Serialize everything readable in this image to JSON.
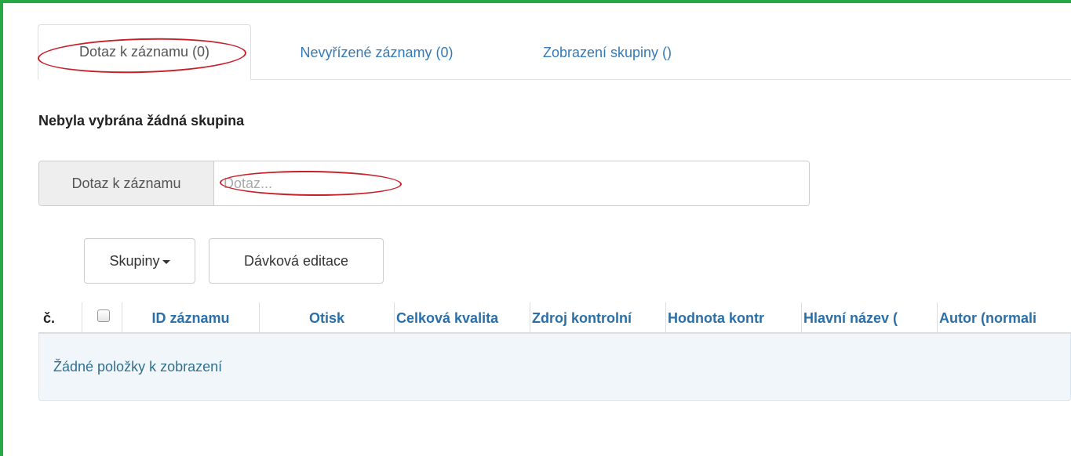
{
  "tabs": [
    {
      "label": "Dotaz k záznamu (0)",
      "active": true
    },
    {
      "label": "Nevyřízené záznamy (0)",
      "active": false
    },
    {
      "label": "Zobrazení skupiny ()",
      "active": false
    }
  ],
  "heading": "Nebyla vybrána žádná skupina",
  "query": {
    "addon_label": "Dotaz k záznamu",
    "placeholder": "Dotaz...",
    "value": ""
  },
  "toolbar": {
    "groups_label": "Skupiny",
    "batch_edit_label": "Dávková editace"
  },
  "table": {
    "columns": [
      "č.",
      "",
      "ID záznamu",
      "Otisk",
      "Celková kvalita",
      "Zdroj kontrolní",
      "Hodnota kontr",
      "Hlavní název (",
      "Autor (normali"
    ],
    "empty_message": "Žádné položky k zobrazení"
  },
  "colors": {
    "frame": "#27a845",
    "annotation": "#c8202a",
    "link": "#337ab7",
    "header_text": "#2a6fa8"
  }
}
